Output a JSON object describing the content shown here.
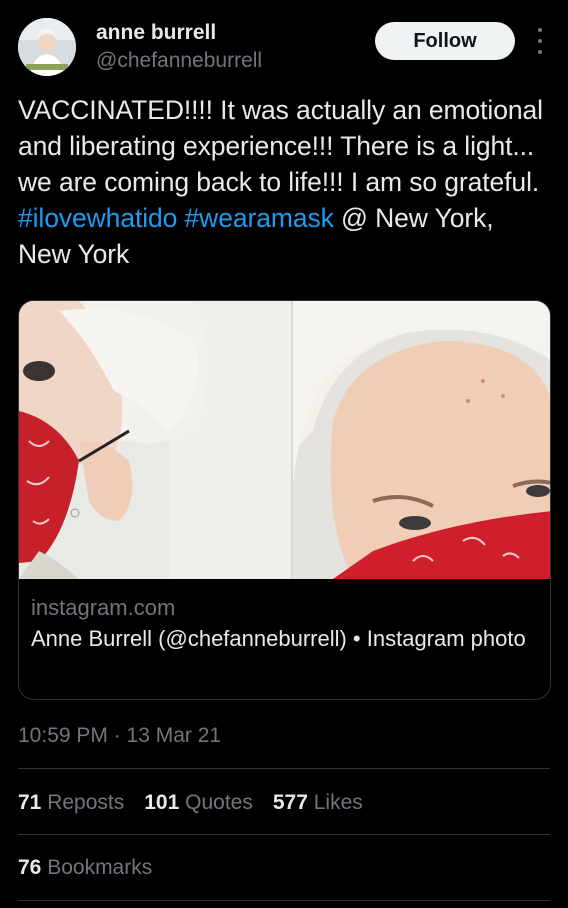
{
  "author": {
    "display_name": "anne burrell",
    "handle": "@chefanneburrell",
    "follow_label": "Follow"
  },
  "tweet": {
    "text_parts": {
      "p1": "VACCINATED!!!! It was actually an emotional and liberating experience!!! There is a light... we are coming back to life!!! I am so grateful. ",
      "hashtag1": "#ilovewhatido",
      "hashtag2": "#wearamask",
      "p2": " @ New York, New York"
    },
    "timestamp": "10:59 PM · 13 Mar 21"
  },
  "link_card": {
    "domain": "instagram.com",
    "title": "Anne Burrell (@chefanneburrell) • Instagram photo"
  },
  "stats": {
    "reposts_count": "71",
    "reposts_label": "Reposts",
    "quotes_count": "101",
    "quotes_label": "Quotes",
    "likes_count": "577",
    "likes_label": "Likes",
    "bookmarks_count": "76",
    "bookmarks_label": "Bookmarks"
  },
  "colors": {
    "background": "#000000",
    "text_primary": "#e7e9ea",
    "text_secondary": "#71767b",
    "link_blue": "#1d9bf0",
    "border": "#2f3336",
    "follow_bg": "#eff3f4"
  }
}
